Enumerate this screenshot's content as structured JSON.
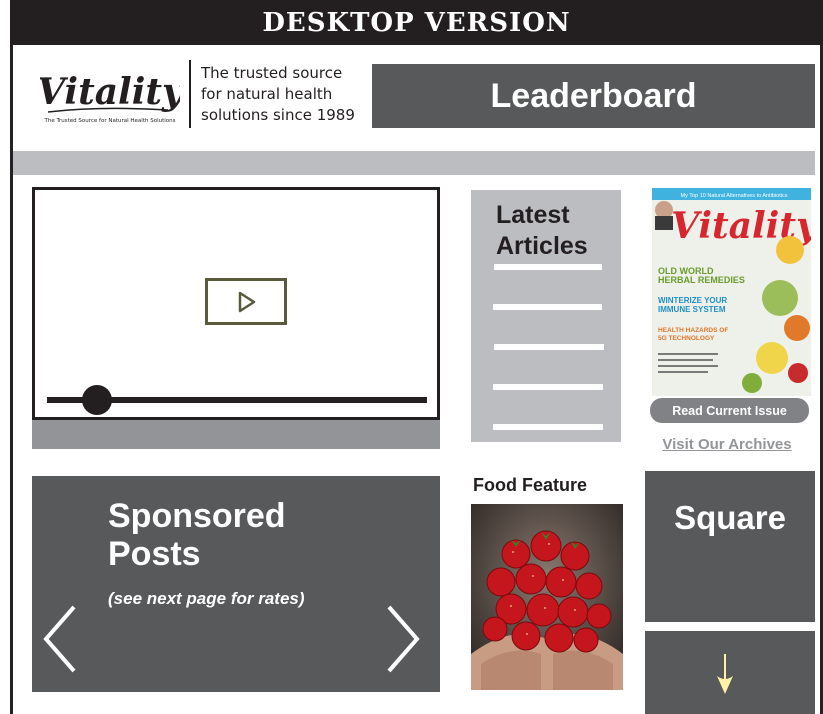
{
  "header": {
    "title": "DESKTOP VERSION"
  },
  "brand": {
    "logo_text": "Vitality",
    "logo_subtext": "The Trusted Source for Natural Health Solutions",
    "tagline_lines": [
      "The trusted source",
      "for natural health",
      "solutions since 1989"
    ]
  },
  "ads": {
    "leaderboard_label": "Leaderboard",
    "square_label": "Square"
  },
  "latest_articles": {
    "title_line1": "Latest",
    "title_line2": "Articles"
  },
  "magazine": {
    "cover_header": "My Top 10 Natural Alternatives to Antibiotics",
    "cover_title": "Vitality",
    "cover_lines": [
      {
        "text": "OLD WORLD",
        "color": "#6a9b2c"
      },
      {
        "text": "HERBAL REMEDIES",
        "color": "#6a9b2c"
      },
      {
        "text": "WINTERIZE YOUR",
        "color": "#1f8fc7"
      },
      {
        "text": "IMMUNE SYSTEM",
        "color": "#1f8fc7"
      },
      {
        "text": "HEALTH HAZARDS OF",
        "color": "#e3762a"
      },
      {
        "text": "5G TECHNOLOGY",
        "color": "#e3762a"
      }
    ],
    "read_button": "Read Current Issue",
    "archives_link": "Visit Our Archives"
  },
  "sponsored": {
    "title_line1": "Sponsored",
    "title_line2": "Posts",
    "subtitle": "(see next page for rates)"
  },
  "food": {
    "title": "Food Feature"
  },
  "icons": {
    "play": "play-icon",
    "prev": "chevron-left-icon",
    "next": "chevron-right-icon",
    "down": "arrow-down-icon"
  },
  "colors": {
    "dark": "#231f20",
    "ad_gray": "#58595b",
    "light_gray": "#bcbdc0",
    "mid_gray": "#929497",
    "arrow_yellow": "#fff2a8"
  }
}
